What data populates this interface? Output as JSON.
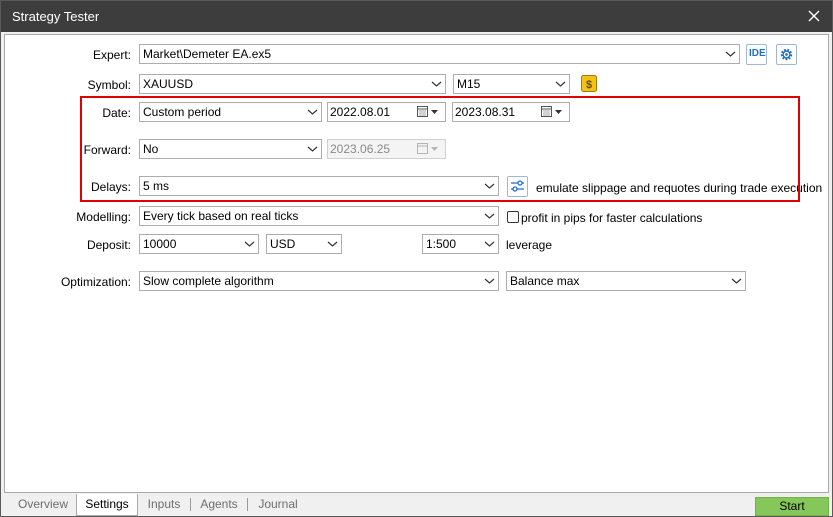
{
  "window": {
    "title": "Strategy Tester"
  },
  "labels": {
    "expert": "Expert:",
    "symbol": "Symbol:",
    "date": "Date:",
    "forward": "Forward:",
    "delays": "Delays:",
    "modelling": "Modelling:",
    "deposit": "Deposit:",
    "optimization": "Optimization:"
  },
  "fields": {
    "expert": "Market\\Demeter EA.ex5",
    "symbol": "XAUUSD",
    "timeframe": "M15",
    "date_mode": "Custom period",
    "date_from": "2022.08.01",
    "date_to": "2023.08.31",
    "forward": "No",
    "forward_date": "2023.06.25",
    "delays": "5 ms",
    "modelling": "Every tick based on real ticks",
    "deposit": "10000",
    "currency": "USD",
    "leverage": "1:500",
    "optimization": "Slow complete algorithm",
    "criterion": "Balance max"
  },
  "texts": {
    "ide": "IDE",
    "emulate": "emulate slippage and requotes during trade execution",
    "profit_pips": "profit in pips for faster calculations",
    "leverage": "leverage"
  },
  "tabs": [
    "Overview",
    "Settings",
    "Inputs",
    "Agents",
    "Journal"
  ],
  "start_label": "Start",
  "colors": {
    "highlight": "#e00000",
    "start": "#86c75a",
    "accent": "#1e6fc5"
  }
}
